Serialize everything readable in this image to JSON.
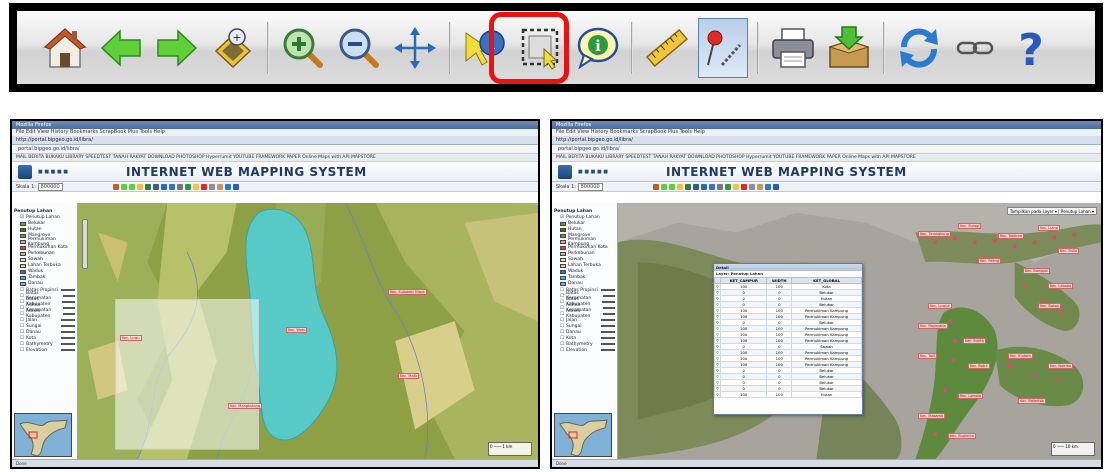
{
  "toolbar": {
    "buttons": [
      {
        "name": "home-button",
        "icon": "home-icon"
      },
      {
        "name": "back-button",
        "icon": "arrow-left-icon"
      },
      {
        "name": "forward-button",
        "icon": "arrow-right-icon"
      },
      {
        "name": "zoom-to-extent-button",
        "icon": "zoom-extent-icon"
      },
      {
        "name": "zoom-in-button",
        "icon": "zoom-in-icon"
      },
      {
        "name": "zoom-out-button",
        "icon": "zoom-out-icon"
      },
      {
        "name": "pan-button",
        "icon": "pan-arrows-icon"
      },
      {
        "name": "identify-button",
        "icon": "identify-icon"
      },
      {
        "name": "select-box-button",
        "icon": "select-box-icon"
      },
      {
        "name": "info-button",
        "icon": "info-bubble-icon"
      },
      {
        "name": "measure-button",
        "icon": "ruler-icon"
      },
      {
        "name": "place-marker-button",
        "icon": "pin-icon"
      },
      {
        "name": "print-button",
        "icon": "printer-icon"
      },
      {
        "name": "export-button",
        "icon": "export-box-icon"
      },
      {
        "name": "refresh-button",
        "icon": "refresh-icon"
      },
      {
        "name": "link-button",
        "icon": "link-icon"
      },
      {
        "name": "help-button",
        "icon": "question-icon"
      }
    ],
    "highlight_color": "#e11111"
  },
  "browser": {
    "window_title": "Mozilla Firefox",
    "menu": "File  Edit  View  History  Bookmarks  ScrapBook Plus  Tools  Help",
    "tab": "http://portal.bipgeo.go.id/libra/",
    "address": "portal.bipgeo.go.id/libra/",
    "bookmarks": "MAIL   BERITA   BUKAKU   LIBRARY   SPEEDTEST   TANAH RAKYAT   DOWNLOAD   PHOTOSHOP   Hyperrumit   YOUTUBE   FRAMEWORK   PAPER   Online Maps with API   MAPSTORE"
  },
  "app": {
    "title": "INTERNET WEB MAPPING SYSTEM",
    "scale_label": "Skala 1:",
    "scale_left": "800000",
    "scale_right": "800000"
  },
  "legend": {
    "groups": [
      {
        "label": "Penutup Lahan",
        "sublabel": "Penutup Lahan"
      },
      {
        "label": "Batas Kabupaten"
      },
      {
        "label": "Sungai"
      },
      {
        "label": "Kota"
      },
      {
        "label": "Administratif"
      }
    ],
    "items": [
      {
        "label": "Belukar",
        "color": "#7a9a2e"
      },
      {
        "label": "Hutan",
        "color": "#2f7a2a"
      },
      {
        "label": "Mangrove",
        "color": "#56a34a"
      },
      {
        "label": "Permukiman Kampung",
        "color": "#e0a0a0"
      },
      {
        "label": "Permukiman Kota",
        "color": "#d24a4a"
      },
      {
        "label": "Perkebunan",
        "color": "#b5c96a"
      },
      {
        "label": "Sawah",
        "color": "#e8e09a"
      },
      {
        "label": "Lahan Terbuka",
        "color": "#e7cda0"
      },
      {
        "label": "Waduk",
        "color": "#2e6ee0"
      },
      {
        "label": "Tambak",
        "color": "#26c7c7"
      },
      {
        "label": "Danau",
        "color": "#6ab1e6"
      }
    ],
    "layers": [
      "Batas Propinsi",
      "Batas Kecamatan",
      "Batas Kabupaten",
      "Admin Kecamatan",
      "Admin Kabupaten",
      "Jalan",
      "Sungai",
      "Danau",
      "Kota",
      "Bathymetry",
      "Elevation"
    ]
  },
  "left_map": {
    "labels": [
      "Kec. Luwu",
      "Kec. Sulawesi Utara",
      "Kec. Wotu",
      "Kec. Mangkutana",
      "Kec. Malili"
    ],
    "lake_color": "#57c9c6"
  },
  "right_map": {
    "layer_select": "Tampilkan pada Layer",
    "layer_option": "Penutup Lahan",
    "popup": {
      "title": "Detail",
      "subtitle": "Layer: Penutup Lahan",
      "columns": [
        "",
        "KET_CAMPUR",
        "WIDTH",
        "KET_GLOBAL"
      ],
      "rows": [
        [
          "100",
          "100",
          "Kota"
        ],
        [
          "0",
          "0",
          "Belukar"
        ],
        [
          "0",
          "0",
          "Hutan"
        ],
        [
          "0",
          "0",
          "Belukar"
        ],
        [
          "100",
          "100",
          "Permukiman Kampung"
        ],
        [
          "100",
          "100",
          "Permukiman Kampung"
        ],
        [
          "0",
          "0",
          "Belukar"
        ],
        [
          "100",
          "100",
          "Permukiman Kampung"
        ],
        [
          "100",
          "100",
          "Permukiman Kampung"
        ],
        [
          "100",
          "100",
          "Permukiman Kampung"
        ],
        [
          "0",
          "0",
          "Sawah"
        ],
        [
          "100",
          "100",
          "Permukiman Kampung"
        ],
        [
          "100",
          "100",
          "Permukiman Kampung"
        ],
        [
          "100",
          "100",
          "Permukiman Kampung"
        ],
        [
          "0",
          "0",
          "Belukar"
        ],
        [
          "0",
          "0",
          "Belukar"
        ],
        [
          "0",
          "0",
          "Belukar"
        ],
        [
          "0",
          "0",
          "Belukar"
        ],
        [
          "100",
          "100",
          "Hutan"
        ]
      ]
    },
    "labels": [
      "Kec. Tinangkung",
      "Kec. Bulagi",
      "Kec. Totikum",
      "Kec. Liang",
      "Kec. Buko",
      "Kec. Peling",
      "Kec. Banggai",
      "Kec. Labobo",
      "Kec. Bokan",
      "Kec. Luwuk",
      "Kec. Pagimana",
      "Kec. Bunta",
      "Kec. Toili",
      "Kec. Batui",
      "Kec. Kintom",
      "Kec. Nambo",
      "Kec. Balantak",
      "Kec. Lamala",
      "Kec. Masama",
      "Kec. Bualemo"
    ]
  }
}
